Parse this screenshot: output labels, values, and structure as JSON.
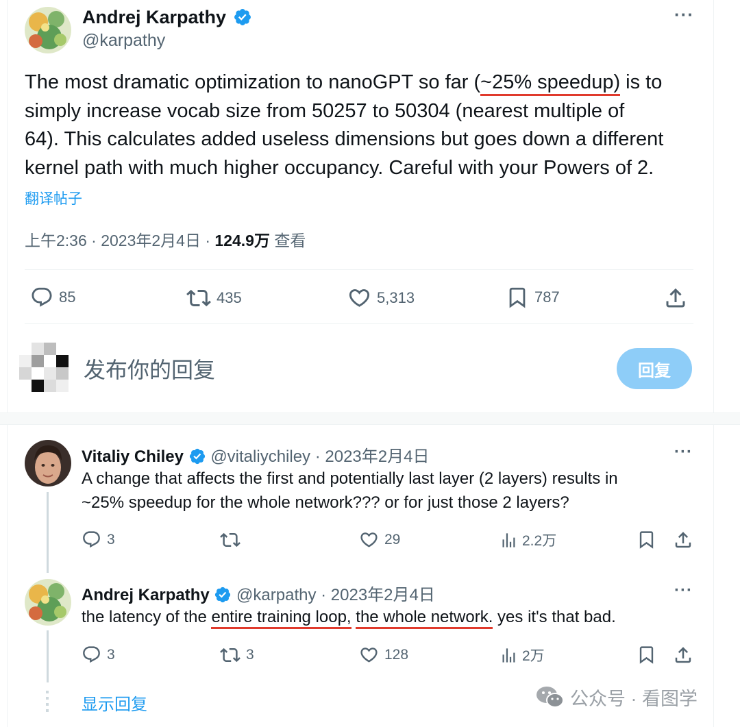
{
  "tweet": {
    "author_name": "Andrej Karpathy",
    "author_handle": "@karpathy",
    "text_lines": [
      [
        "The most dramatic optimization to nanoGPT so far (",
        "~25% speedup)",
        " is to"
      ],
      "simply increase vocab size from 50257 to 50304 (nearest multiple of",
      "64). This calculates added useless dimensions but goes down a different",
      "kernel path with much higher occupancy. Careful with your Powers of 2."
    ],
    "translate_label": "翻译帖子",
    "time": "上午2:36 · 2023年2月4日 · ",
    "views": "124.9万",
    "views_label": " 查看",
    "stats": {
      "replies": "85",
      "retweets": "435",
      "likes": "5,313",
      "bookmarks": "787"
    }
  },
  "compose": {
    "placeholder": "发布你的回复",
    "reply_button": "回复"
  },
  "replies": [
    {
      "author_name": "Vitaliy Chiley",
      "author_handle": "@vitaliychiley",
      "date": " · 2023年2月4日",
      "text_lines": [
        "A change that affects the first and potentially last layer (2 layers) results in",
        "~25% speedup for the whole network??? or for just those 2 layers?"
      ],
      "stats": {
        "replies": "3",
        "retweets": "",
        "likes": "29",
        "views": "2.2万"
      }
    },
    {
      "author_name": "Andrej Karpathy",
      "author_handle": "@karpathy",
      "date": " · 2023年2月4日",
      "text_parts": [
        "the latency of the ",
        "entire training loop,",
        " ",
        "the whole network.",
        " yes it's that bad."
      ],
      "stats": {
        "replies": "3",
        "retweets": "3",
        "likes": "128",
        "views": "2万"
      }
    }
  ],
  "show_replies": "显示回复",
  "watermark": "公众号 · 看图学",
  "colors": {
    "accent": "#1d9bf0",
    "underline": "#e03a2c",
    "muted": "#536471",
    "verified": "#1d9bf0"
  },
  "icons": [
    "more-icon",
    "verified-icon",
    "reply-icon",
    "retweet-icon",
    "like-icon",
    "bookmark-icon",
    "share-icon",
    "views-icon",
    "wechat-icon"
  ]
}
